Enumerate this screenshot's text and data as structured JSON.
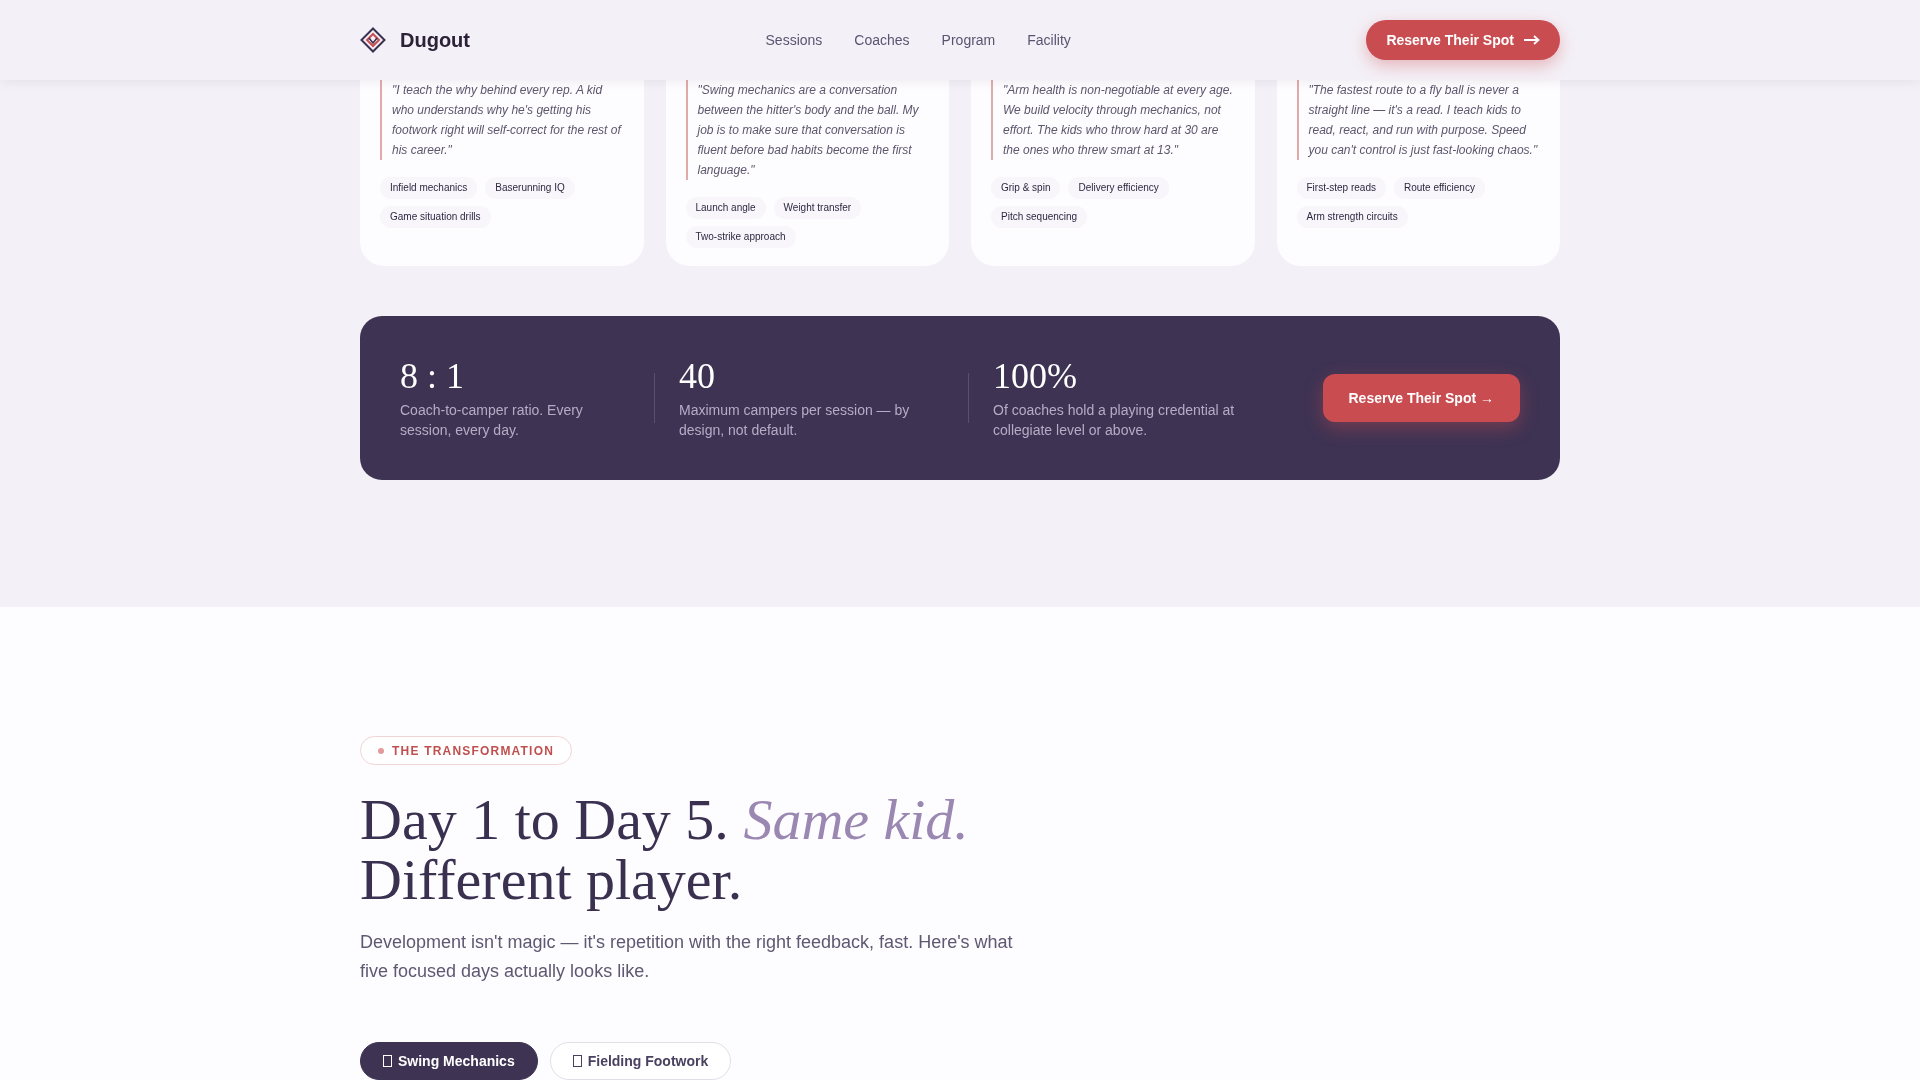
{
  "header": {
    "brand": "Dugout",
    "nav": [
      "Sessions",
      "Coaches",
      "Program",
      "Facility"
    ],
    "cta": "Reserve Their Spot"
  },
  "coach_cards": [
    {
      "quote": "\"I teach the why behind every rep. A kid who understands why he's getting his footwork right will self-correct for the rest of his career.\"",
      "tags": [
        "Infield mechanics",
        "Baserunning IQ",
        "Game situation drills"
      ]
    },
    {
      "quote": "\"Swing mechanics are a conversation between the hitter's body and the ball. My job is to make sure that conversation is fluent before bad habits become the first language.\"",
      "tags": [
        "Launch angle",
        "Weight transfer",
        "Two-strike approach"
      ]
    },
    {
      "quote": "\"Arm health is non-negotiable at every age. We build velocity through mechanics, not effort. The kids who throw hard at 30 are the ones who threw smart at 13.\"",
      "tags": [
        "Grip & spin",
        "Delivery efficiency",
        "Pitch sequencing"
      ]
    },
    {
      "quote": "\"The fastest route to a fly ball is never a straight line — it's a read. I teach kids to read, react, and run with purpose. Speed you can't control is just fast-looking chaos.\"",
      "tags": [
        "First-step reads",
        "Route efficiency",
        "Arm strength circuits"
      ]
    }
  ],
  "stats_band": {
    "stats": [
      {
        "value": "8 : 1",
        "description": "Coach-to-camper ratio. Every session, every day."
      },
      {
        "value": "40",
        "description": "Maximum campers per session — by design, not default."
      },
      {
        "value": "100%",
        "description": "Of coaches hold a playing credential at collegiate level or above."
      }
    ],
    "cta": "Reserve Their Spot →"
  },
  "transformation": {
    "eyebrow": "THE TRANSFORMATION",
    "heading": "Day 1 to Day 5. *Same kid.* Different player.",
    "intro": "Development isn't magic — it's repetition with the right feedback, fast. Here's what five focused days actually looks like.",
    "tabs": [
      {
        "label": "Swing Mechanics",
        "selected": true
      },
      {
        "label": "Fielding Footwork",
        "selected": false
      }
    ]
  }
}
